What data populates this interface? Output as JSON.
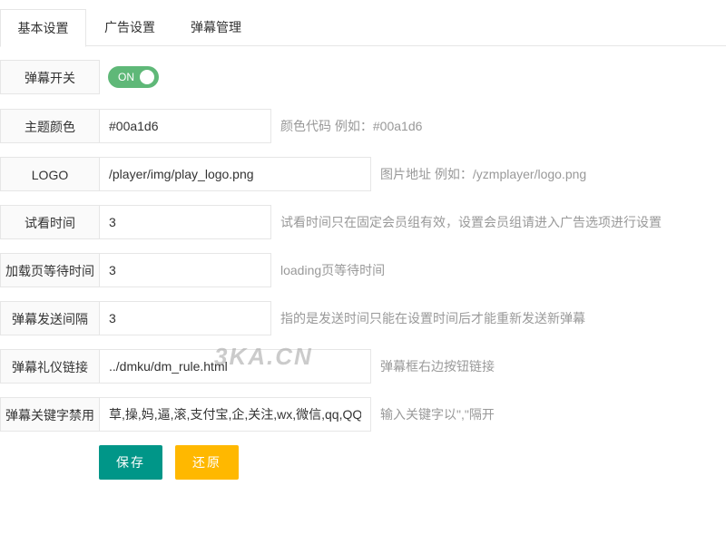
{
  "tabs": [
    "基本设置",
    "广告设置",
    "弹幕管理"
  ],
  "switch": {
    "label": "弹幕开关",
    "state_text": "ON",
    "on": true,
    "color": "#5fb878"
  },
  "fields": {
    "theme_color": {
      "label": "主题颜色",
      "value": "#00a1d6",
      "hint": "颜色代码 例如：#00a1d6"
    },
    "logo": {
      "label": "LOGO",
      "value": "/player/img/play_logo.png",
      "hint": "图片地址 例如：/yzmplayer/logo.png"
    },
    "trial_time": {
      "label": "试看时间",
      "value": "3",
      "hint": "试看时间只在固定会员组有效，设置会员组请进入广告选项进行设置"
    },
    "loading_wait": {
      "label": "加载页等待时间",
      "value": "3",
      "hint": "loading页等待时间"
    },
    "danmaku_interval": {
      "label": "弹幕发送间隔",
      "value": "3",
      "hint": "指的是发送时间只能在设置时间后才能重新发送新弹幕"
    },
    "etiquette_link": {
      "label": "弹幕礼仪链接",
      "value": "../dmku/dm_rule.html",
      "hint": "弹幕框右边按钮链接"
    },
    "keyword_ban": {
      "label": "弹幕关键字禁用",
      "value": "草,操,妈,逼,滚,支付宝,企,关注,wx,微信,qq,QQ",
      "hint": "输入关键字以\",\"隔开"
    }
  },
  "buttons": {
    "save": "保存",
    "reset": "还原",
    "save_color": "#009688",
    "reset_color": "#ffb800"
  },
  "watermark": "3KA.CN"
}
